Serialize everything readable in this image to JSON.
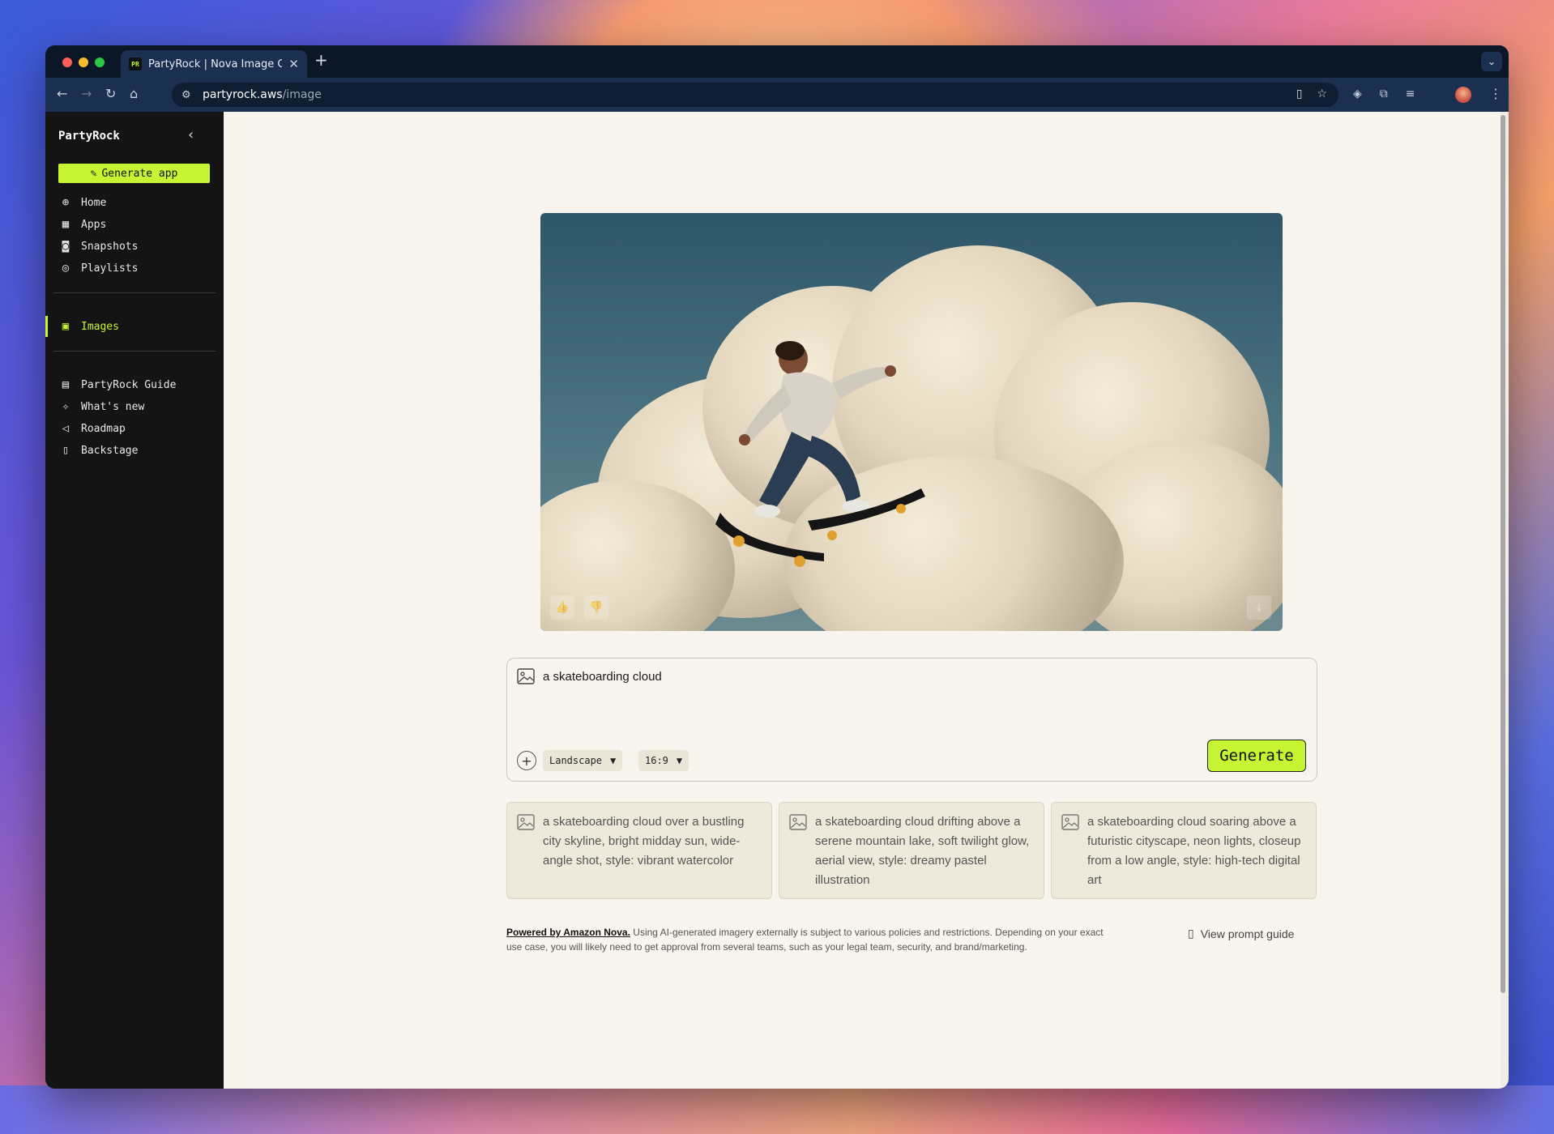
{
  "browser": {
    "tab_title": "PartyRock | Nova Image Generator",
    "tab_favicon_text": "PR",
    "url_host": "partyrock.aws",
    "url_path": "/image"
  },
  "sidebar": {
    "brand": "PartyRock",
    "generate_app_label": "Generate app",
    "primary_items": [
      {
        "label": "Home",
        "icon": "globe-icon"
      },
      {
        "label": "Apps",
        "icon": "layout-icon"
      },
      {
        "label": "Snapshots",
        "icon": "camera-icon"
      },
      {
        "label": "Playlists",
        "icon": "playlist-icon"
      }
    ],
    "images_item": {
      "label": "Images",
      "icon": "image-icon",
      "active": true
    },
    "secondary_items": [
      {
        "label": "PartyRock Guide",
        "icon": "book-icon"
      },
      {
        "label": "What's new",
        "icon": "sparkle-icon"
      },
      {
        "label": "Roadmap",
        "icon": "megaphone-icon"
      },
      {
        "label": "Backstage",
        "icon": "door-icon"
      }
    ]
  },
  "prompt": {
    "text": "a skateboarding cloud",
    "orientation": "Landscape",
    "aspect_ratio": "16:9",
    "generate_label": "Generate"
  },
  "suggestions": [
    "a skateboarding cloud over a bustling city skyline, bright midday sun, wide-angle shot, style: vibrant watercolor",
    "a skateboarding cloud drifting above a serene mountain lake, soft twilight glow, aerial view, style: dreamy pastel illustration",
    "a skateboarding cloud soaring above a futuristic cityscape, neon lights, closeup from a low angle, style: high-tech digital art"
  ],
  "footer": {
    "powered_by": "Powered by Amazon Nova.",
    "disclaimer": "Using AI-generated imagery externally is subject to various policies and restrictions. Depending on your exact use case, you will likely need to get approval from several teams, such as your legal team, security, and brand/marketing.",
    "prompt_guide_label": "View prompt guide"
  },
  "colors": {
    "accent": "#c6f432",
    "sidebar_bg": "#141414",
    "main_bg": "#f8f5ee"
  }
}
